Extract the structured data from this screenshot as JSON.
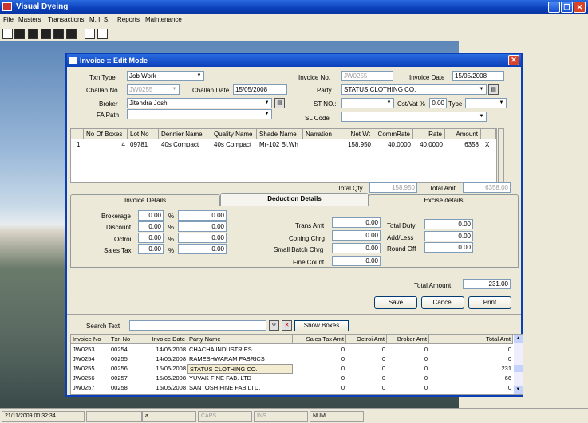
{
  "app": {
    "title": "Visual Dyeing"
  },
  "menu": [
    "File",
    "Masters",
    "Transactions",
    "M. I. S.",
    "Reports",
    "Maintenance"
  ],
  "dialog": {
    "title": "Invoice :: Edit Mode",
    "txn_type_label": "Txn Type",
    "txn_type": "Job Work",
    "challan_no_label": "Challan No",
    "challan_no": "JW0255",
    "challan_date_label": "Challan Date",
    "challan_date": "15/05/2008",
    "broker_label": "Broker",
    "broker": "Jitendra Joshi",
    "fa_path_label": "FA Path",
    "fa_path": "",
    "invoice_no_label": "Invoice No.",
    "invoice_no": "JW0255",
    "invoice_date_label": "Invoice Date",
    "invoice_date": "15/05/2008",
    "party_label": "Party",
    "party": "STATUS CLOTHING CO.",
    "st_no_label": "ST NO.:",
    "st_no": "",
    "cst_label": "Cst/Vat %",
    "cst": "0.00",
    "type_label": "Type",
    "type": "",
    "sl_code_label": "SL Code",
    "sl_code": ""
  },
  "items_grid": {
    "headers": [
      "No Of Boxes",
      "Lot No",
      "Dennier Name",
      "Quality Name",
      "Shade Name",
      "Narration",
      "Net Wt",
      "CommRate",
      "Rate",
      "Amount"
    ],
    "rows": [
      {
        "idx": "1",
        "boxes": "4",
        "lot": "09781",
        "dennier": "40s Compact",
        "quality": "40s Compact",
        "shade": "Mr-102  Bl.Wh",
        "narration": "",
        "netwt": "158.950",
        "commrate": "40.0000",
        "rate": "40.0000",
        "amount": "6358",
        "del": "X"
      }
    ]
  },
  "totals": {
    "total_qty_label": "Total Qty",
    "total_qty": "158.950",
    "total_amt_label": "Total Amt",
    "total_amt": "6358.00"
  },
  "tabs": [
    "Invoice Details",
    "Deduction Details",
    "Excise details"
  ],
  "deduction": {
    "brokerage_label": "Brokerage",
    "brokerage_pct": "0.00",
    "brokerage_amt": "0.00",
    "discount_label": "Discount",
    "discount_pct": "0.00",
    "discount_amt": "0.00",
    "octroi_label": "Octroi",
    "octroi_pct": "0.00",
    "octroi_amt": "0.00",
    "sales_tax_label": "Sales Tax",
    "sales_tax_pct": "0.00",
    "sales_tax_amt": "0.00",
    "pct": "%",
    "trans_amt_label": "Trans Amt",
    "trans_amt": "0.00",
    "coning_label": "Coning Chrg",
    "coning": "0.00",
    "small_batch_label": "Small Batch Chrg",
    "small_batch": "0.00",
    "fine_count_label": "Fine Count",
    "fine_count": "0.00",
    "total_duty_label": "Total Duty",
    "total_duty": "0.00",
    "add_less_label": "Add/Less",
    "add_less": "0.00",
    "round_off_label": "Round Off",
    "round_off": "0.00"
  },
  "total_amount_label": "Total Amount",
  "total_amount": "231.00",
  "buttons": {
    "save": "Save",
    "cancel": "Cancel",
    "print": "Print",
    "show_boxes": "Show Boxes"
  },
  "search": {
    "label": "Search Text",
    "value": ""
  },
  "list_grid": {
    "headers": [
      "Invoice No",
      "Txn No",
      "Invoice Date",
      "Party Name",
      "Sales Tax Amt",
      "Octroi Amt",
      "Broker Amt",
      "Total Amt"
    ],
    "rows": [
      [
        "JW0253",
        "00254",
        "14/05/2008",
        "CHACHA INDUSTRIES",
        "0",
        "0",
        "0",
        "0"
      ],
      [
        "JW0254",
        "00255",
        "14/05/2008",
        "RAMESHWARAM FABRICS",
        "0",
        "0",
        "0",
        "0"
      ],
      [
        "JW0255",
        "00256",
        "15/05/2008",
        "STATUS CLOTHING CO.",
        "0",
        "0",
        "0",
        "231"
      ],
      [
        "JW0256",
        "00257",
        "15/05/2008",
        "YUVAK FINE FAB. LTD",
        "0",
        "0",
        "0",
        "66"
      ],
      [
        "JW0257",
        "00258",
        "15/05/2008",
        "SANTOSH FINE FAB LTD.",
        "0",
        "0",
        "0",
        "0"
      ]
    ]
  },
  "status": {
    "datetime": "21/11/2009 00:32:34",
    "a": "a",
    "caps": "CAPS",
    "ins": "INS",
    "num": "NUM"
  }
}
